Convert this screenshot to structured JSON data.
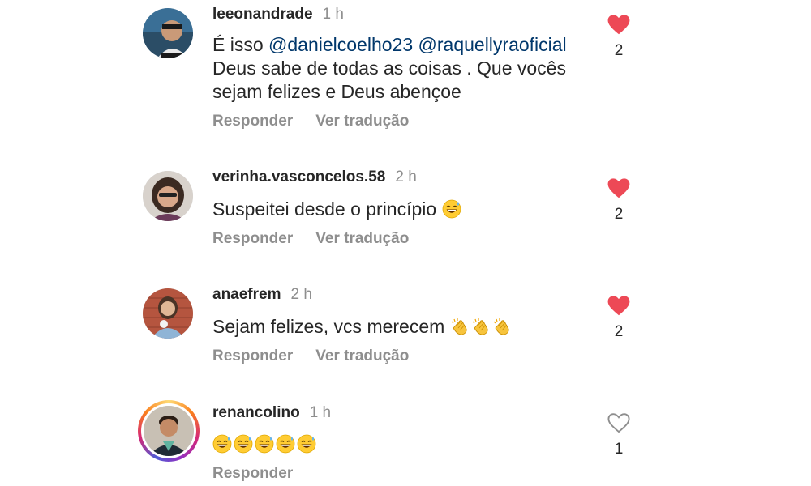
{
  "colors": {
    "heart_filled": "#ed4956",
    "mention": "#00376b",
    "secondary": "#8e8e8e"
  },
  "comments": [
    {
      "username": "leeonandrade",
      "time": "1 h",
      "text_prefix": "É isso ",
      "mentions": [
        "@danielcoelho23",
        "@raquellyraoficial"
      ],
      "text_suffix": "Deus sabe de todas as coisas . Que vocês sejam felizes e Deus abençoe",
      "reply": "Responder",
      "translate": "Ver tradução",
      "liked": true,
      "likes": "2"
    },
    {
      "username": "verinha.vasconcelos.58",
      "time": "2 h",
      "text": "Suspeitei desde o princípio",
      "emoji": [
        "grinning-face-sweat"
      ],
      "reply": "Responder",
      "translate": "Ver tradução",
      "liked": true,
      "likes": "2"
    },
    {
      "username": "anaefrem",
      "time": "2 h",
      "text": "Sejam felizes, vcs merecem",
      "emoji": [
        "clapping-hands",
        "clapping-hands",
        "clapping-hands"
      ],
      "reply": "Responder",
      "translate": "Ver tradução",
      "liked": true,
      "likes": "2"
    },
    {
      "username": "renancolino",
      "time": "1 h",
      "emoji": [
        "grinning-face-sweat",
        "grinning-face-sweat",
        "grinning-face-sweat",
        "grinning-face-sweat",
        "grinning-face-sweat"
      ],
      "reply": "Responder",
      "liked": false,
      "likes": "1",
      "has_story_ring": true
    }
  ]
}
